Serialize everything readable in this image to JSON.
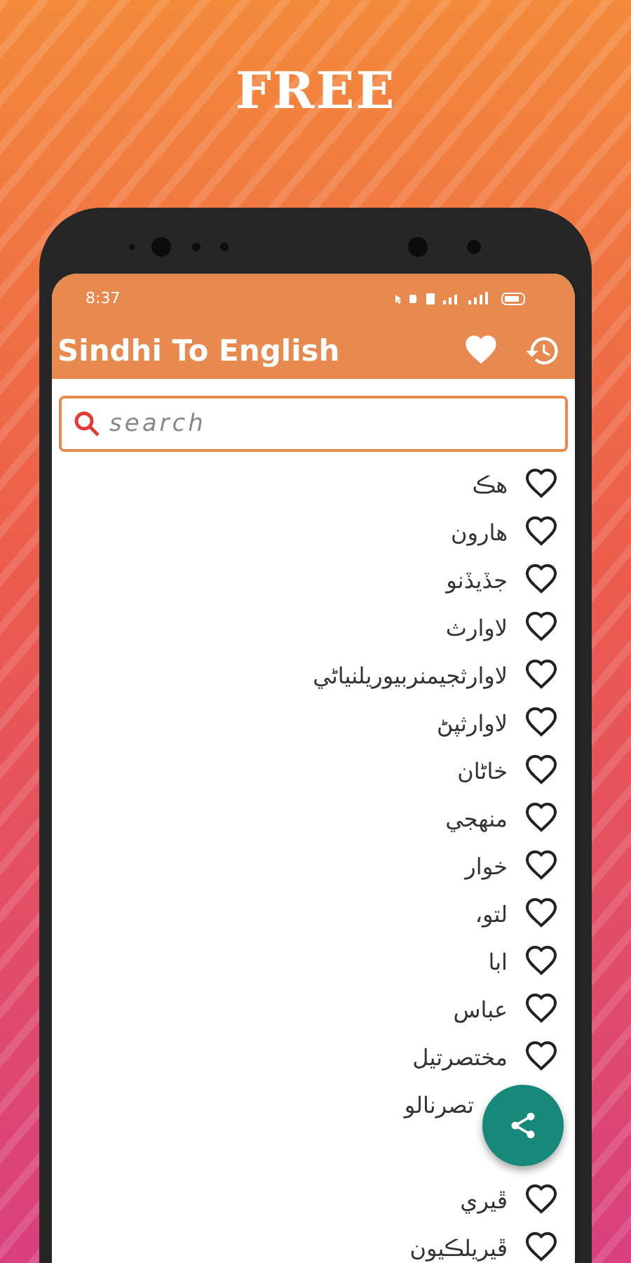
{
  "banner": {
    "title": "FREE"
  },
  "status_bar": {
    "time": "8:37"
  },
  "app_bar": {
    "title": "Sindhi To English"
  },
  "search": {
    "placeholder": "search"
  },
  "words": [
    {
      "word": "هڪ"
    },
    {
      "word": "هارون"
    },
    {
      "word": "جڏيڏنو"
    },
    {
      "word": "لاوارث"
    },
    {
      "word": "لاوارثجيمنربيوريلنياڻي"
    },
    {
      "word": "لاوارثپڻ"
    },
    {
      "word": "خاڻان"
    },
    {
      "word": "منهجي"
    },
    {
      "word": "خوار"
    },
    {
      "word": "لتو،"
    },
    {
      "word": "ابا"
    },
    {
      "word": "عباس"
    },
    {
      "word": "مختصرتيل"
    },
    {
      "kind": "covered",
      "word": "تصرنالو"
    },
    {
      "kind": "hidden"
    },
    {
      "word": "ڦيري"
    },
    {
      "word": "ڦيريلڪيون"
    }
  ]
}
